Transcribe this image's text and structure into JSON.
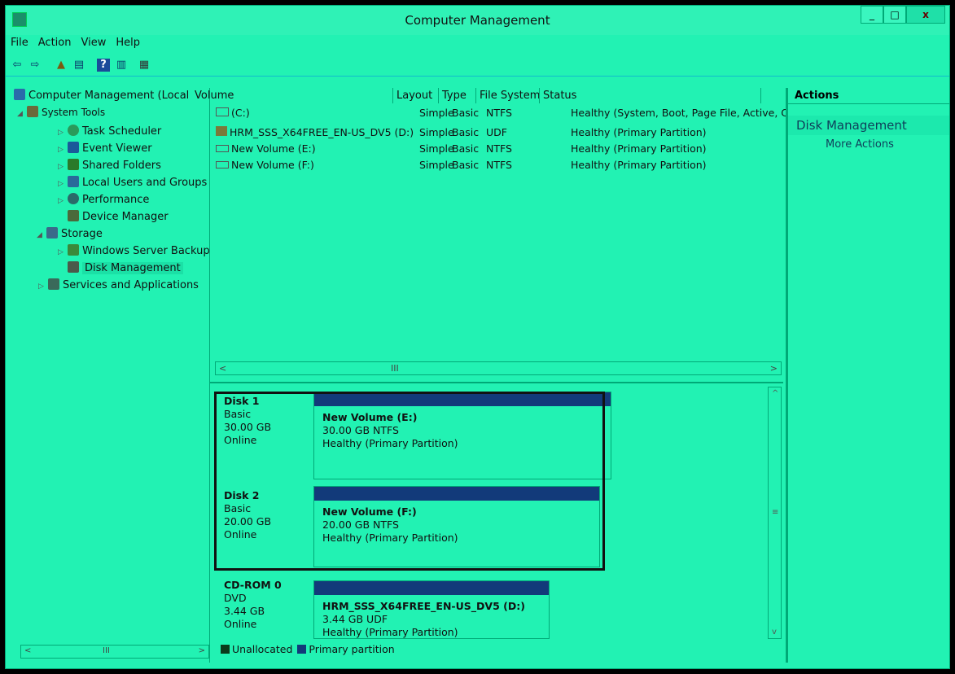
{
  "window": {
    "title": "Computer Management",
    "min": "_",
    "max": "□",
    "close": "x"
  },
  "menu": [
    "File",
    "Action",
    "View",
    "Help"
  ],
  "tree": {
    "root": "Computer Management (Local",
    "system_tools": "System Tools",
    "items": [
      {
        "label": "Task Scheduler",
        "icon": "clock-icon",
        "color": "#2a9a5a"
      },
      {
        "label": "Event Viewer",
        "icon": "event-viewer-icon",
        "color": "#1a5a9a"
      },
      {
        "label": "Shared Folders",
        "icon": "shared-folder-icon",
        "color": "#2a7a2a"
      },
      {
        "label": "Local Users and Groups",
        "icon": "users-icon",
        "color": "#2a6a9a"
      },
      {
        "label": "Performance",
        "icon": "performance-icon",
        "color": "#2a6a6a"
      },
      {
        "label": "Device Manager",
        "icon": "device-manager-icon",
        "color": "#4a6a3a"
      }
    ],
    "storage": "Storage",
    "storage_items": [
      {
        "label": "Windows Server Backup",
        "icon": "backup-icon"
      },
      {
        "label": "Disk Management",
        "icon": "disk-icon"
      }
    ],
    "services": "Services and Applications"
  },
  "columns": [
    "Volume",
    "Layout",
    "Type",
    "File System",
    "Status"
  ],
  "volumes": [
    {
      "name": "(C:)",
      "layout": "Simple",
      "type": "Basic",
      "fs": "NTFS",
      "status": "Healthy (System, Boot, Page File, Active, C"
    },
    {
      "name": "HRM_SSS_X64FREE_EN-US_DV5 (D:)",
      "layout": "Simple",
      "type": "Basic",
      "fs": "UDF",
      "status": "Healthy (Primary Partition)"
    },
    {
      "name": "New Volume (E:)",
      "layout": "Simple",
      "type": "Basic",
      "fs": "NTFS",
      "status": "Healthy (Primary Partition)"
    },
    {
      "name": "New Volume (F:)",
      "layout": "Simple",
      "type": "Basic",
      "fs": "NTFS",
      "status": "Healthy (Primary Partition)"
    }
  ],
  "disks": [
    {
      "name": "Disk 1",
      "type": "Basic",
      "size": "30.00 GB",
      "state": "Online",
      "part_name": "New Volume  (E:)",
      "part_size": "30.00 GB NTFS",
      "part_status": "Healthy (Primary Partition)"
    },
    {
      "name": "Disk 2",
      "type": "Basic",
      "size": "20.00 GB",
      "state": "Online",
      "part_name": "New Volume  (F:)",
      "part_size": "20.00 GB NTFS",
      "part_status": "Healthy (Primary Partition)"
    },
    {
      "name": "CD-ROM 0",
      "type": "DVD",
      "size": "3.44 GB",
      "state": "Online",
      "part_name": "HRM_SSS_X64FREE_EN-US_DV5  (D:)",
      "part_size": "3.44 GB UDF",
      "part_status": "Healthy (Primary Partition)"
    }
  ],
  "legend": {
    "unallocated": "Unallocated",
    "primary": "Primary partition",
    "unallocated_color": "#0b3b1b",
    "primary_color": "#123a7a"
  },
  "actions": {
    "header": "Actions",
    "section": "Disk Management",
    "more": "More Actions"
  },
  "scroll": {
    "thumb": "III"
  }
}
